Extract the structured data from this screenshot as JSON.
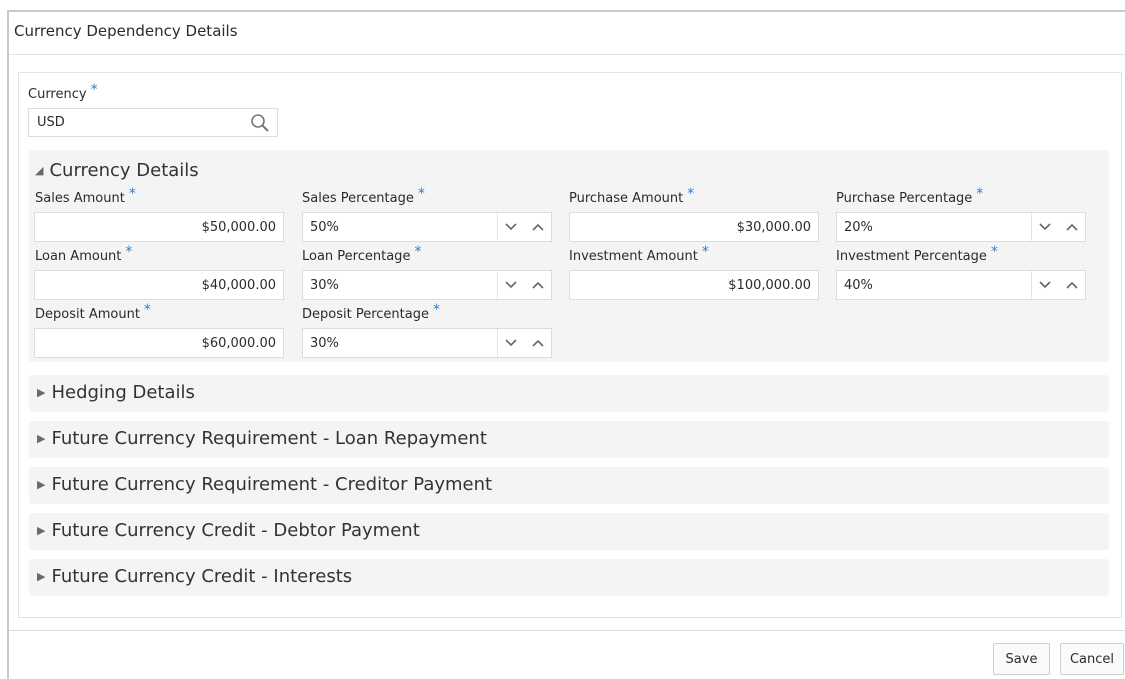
{
  "page": {
    "title": "Currency Dependency Details"
  },
  "required_marker": "*",
  "currency": {
    "label": "Currency",
    "value": "USD"
  },
  "sections": {
    "currency_details": {
      "title": "Currency Details",
      "fields": {
        "sales_amount": {
          "label": "Sales Amount",
          "value": "$50,000.00"
        },
        "sales_percentage": {
          "label": "Sales Percentage",
          "value": "50%"
        },
        "purchase_amount": {
          "label": "Purchase Amount",
          "value": "$30,000.00"
        },
        "purchase_percentage": {
          "label": "Purchase Percentage",
          "value": "20%"
        },
        "loan_amount": {
          "label": "Loan Amount",
          "value": "$40,000.00"
        },
        "loan_percentage": {
          "label": "Loan Percentage",
          "value": "30%"
        },
        "investment_amount": {
          "label": "Investment Amount",
          "value": "$100,000.00"
        },
        "investment_percentage": {
          "label": "Investment Percentage",
          "value": "40%"
        },
        "deposit_amount": {
          "label": "Deposit Amount",
          "value": "$60,000.00"
        },
        "deposit_percentage": {
          "label": "Deposit Percentage",
          "value": "30%"
        }
      }
    },
    "hedging": {
      "title": "Hedging Details"
    },
    "loan_repayment": {
      "title": "Future Currency Requirement - Loan Repayment"
    },
    "creditor_payment": {
      "title": "Future Currency Requirement - Creditor Payment"
    },
    "debtor_payment": {
      "title": "Future Currency Credit - Debtor Payment"
    },
    "interests": {
      "title": "Future Currency Credit - Interests"
    }
  },
  "footer": {
    "save_label": "Save",
    "cancel_label": "Cancel"
  },
  "colors": {
    "required_accent": "#2a7fd4",
    "section_bg": "#f4f4f4",
    "border": "#dcdcdc"
  },
  "icons": {
    "search": "search-icon",
    "expanded": "triangle-down-icon",
    "collapsed": "triangle-right-icon",
    "spin_down": "chevron-down-icon",
    "spin_up": "chevron-up-icon"
  }
}
